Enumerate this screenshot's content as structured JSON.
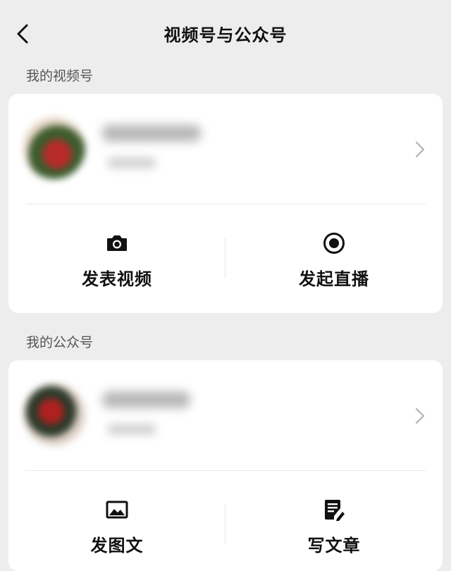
{
  "nav": {
    "title": "视频号与公众号",
    "back_icon": "chevron-left-icon"
  },
  "channels": {
    "section_label": "我的视频号",
    "profile": {
      "avatar_colors": [
        "#b82a2a",
        "#3d5c2e",
        "#e8d8c8"
      ]
    },
    "actions": [
      {
        "label": "发表视频",
        "icon": "camera-icon"
      },
      {
        "label": "发起直播",
        "icon": "live-record-icon"
      }
    ]
  },
  "official_account": {
    "section_label": "我的公众号",
    "profile": {
      "avatar_colors": [
        "#b02020",
        "#2d3a2a",
        "#ddd0c6"
      ]
    },
    "actions": [
      {
        "label": "发图文",
        "icon": "image-icon"
      },
      {
        "label": "写文章",
        "icon": "edit-document-icon"
      }
    ]
  }
}
